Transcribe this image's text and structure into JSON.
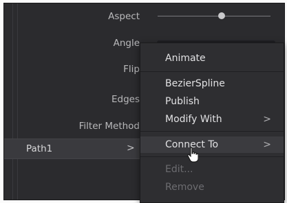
{
  "properties": {
    "aspect": "Aspect",
    "angle": "Angle",
    "flip": "Flip",
    "edges": "Edges",
    "filter_method": "Filter Method"
  },
  "path_row": {
    "label": "Path1",
    "arrow": ">"
  },
  "context_menu": {
    "items": [
      {
        "label": "Animate"
      },
      {
        "label": "BezierSpline"
      },
      {
        "label": "Publish"
      },
      {
        "label": "Modify With",
        "arrow": ">"
      },
      {
        "label": "Connect To",
        "arrow": ">"
      },
      {
        "label": "Edit..."
      },
      {
        "label": "Remove"
      }
    ]
  },
  "colors": {
    "panel_bg": "#2b2b2e",
    "menu_bg": "#2e2e31",
    "hover_bg": "#3b3b3f",
    "text": "#e2e2e4",
    "disabled_text": "#6c6c70"
  }
}
